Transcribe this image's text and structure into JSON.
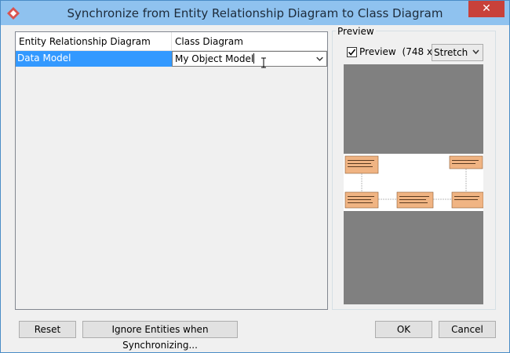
{
  "window": {
    "title": "Synchronize from Entity Relationship Diagram to Class Diagram",
    "close_glyph": "✕"
  },
  "table": {
    "columns": [
      "Entity Relationship Diagram",
      "Class Diagram"
    ],
    "rows": [
      {
        "er_diagram": "Data Model",
        "class_diagram": "My Object Model"
      }
    ]
  },
  "preview": {
    "group_label": "Preview",
    "checkbox_label": "Preview",
    "checkbox_checked": true,
    "size_text": "(748 x...",
    "scale_selected": "Stretch"
  },
  "buttons": {
    "reset": "Reset",
    "ignore": "Ignore Entities when Synchronizing...",
    "ok": "OK",
    "cancel": "Cancel"
  },
  "colors": {
    "titlebar": "#8fc2ef",
    "selection": "#3399ff",
    "close": "#c8413a",
    "entity_fill": "#f0b483"
  }
}
